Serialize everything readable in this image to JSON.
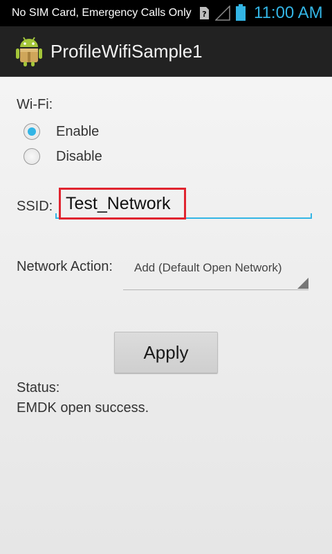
{
  "status_bar": {
    "text": "No SIM Card, Emergency Calls Only",
    "time": "11:00 AM",
    "icons": [
      "sim-missing-icon",
      "signal-empty-icon",
      "battery-icon"
    ],
    "accent_color": "#33b5e5"
  },
  "action_bar": {
    "app_icon": "android-icon",
    "title": "ProfileWifiSample1"
  },
  "form": {
    "wifi_label": "Wi-Fi:",
    "wifi_options": [
      {
        "label": "Enable",
        "checked": true
      },
      {
        "label": "Disable",
        "checked": false
      }
    ],
    "ssid_label": "SSID:",
    "ssid_value": "Test_Network",
    "network_action_label": "Network Action:",
    "network_action_selected": "Add (Default Open Network)",
    "apply_label": "Apply",
    "status_label": "Status:",
    "status_message": "EMDK open success."
  },
  "colors": {
    "accent": "#33b5e5",
    "highlight_box": "#e0242f"
  }
}
